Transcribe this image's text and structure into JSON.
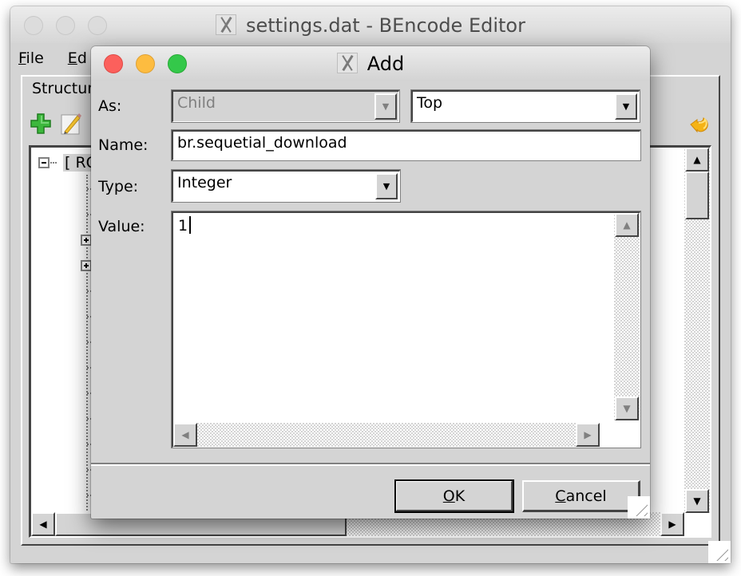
{
  "main_window": {
    "title": "settings.dat - BEncode Editor",
    "menu": [
      {
        "mnemonic": "F",
        "rest": "ile"
      },
      {
        "mnemonic": "E",
        "rest": "d"
      }
    ],
    "tab_label": "Structur",
    "toolbar": {
      "add_icon": "green-plus-icon",
      "edit_icon": "pencil-note-icon",
      "revert_icon": "revert-arrow-icon"
    },
    "tree": {
      "root_label": "[ RO",
      "expand_glyph": "+",
      "collapse_glyph": "−"
    },
    "scroll_glyphs": {
      "up": "▲",
      "down": "▼",
      "left": "◀",
      "right": "▶"
    }
  },
  "dialog": {
    "title": "Add",
    "fields": {
      "as_label": "As:",
      "as_value": "Child",
      "position_value": "Top",
      "name_label": "Name:",
      "name_value": "br.sequetial_download",
      "type_label": "Type:",
      "type_value": "Integer",
      "value_label": "Value:",
      "value_value": "1"
    },
    "combo_arrow": "▼",
    "buttons": {
      "ok_mnemonic": "O",
      "ok_rest": "K",
      "cancel_mnemonic": "C",
      "cancel_rest": "ancel"
    }
  },
  "colors": {
    "close": "#fc605c",
    "minimize": "#fdbc40",
    "zoom": "#34c84a",
    "face": "#d4d4d4"
  }
}
